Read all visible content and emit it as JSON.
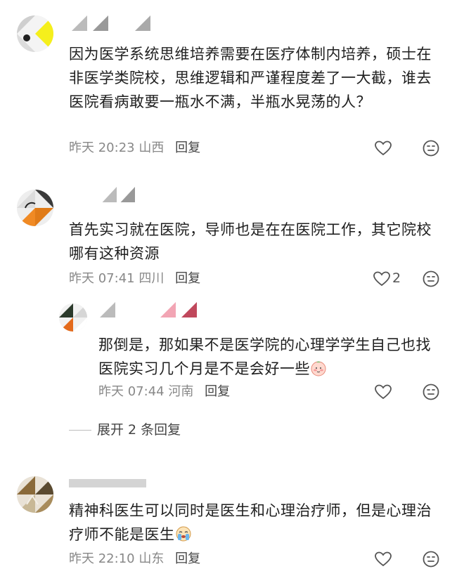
{
  "comments": [
    {
      "text": "因为医学系统思维培养需要在医疗体制内培养，硕士在非医学类院校，思维逻辑和严谨程度差了一大截，谁去医院看病敢要一瓶水不满，半瓶水晃荡的人？",
      "time": "昨天 20:23",
      "location": "山西",
      "reply_label": "回复",
      "like_icon": "heart-outline-icon",
      "dislike_icon": "neutral-face-icon"
    },
    {
      "text": "首先实习就在医院，导师也是在在医院工作，其它院校哪有这种资源",
      "time": "昨天 07:41",
      "location": "四川",
      "reply_label": "回复",
      "like_count": "2",
      "like_icon": "heart-outline-icon",
      "dislike_icon": "neutral-face-icon"
    },
    {
      "text": "那倒是，那如果不是医学院的心理学学生自己也找医院实习几个月是不是会好一些",
      "time": "昨天 07:44",
      "location": "河南",
      "reply_label": "回复",
      "emoji": "shy-face-emoji",
      "like_icon": "heart-outline-icon",
      "dislike_icon": "neutral-face-icon"
    },
    {
      "text": "精神科医生可以同时是医生和心理治疗师，但是心理治疗师不能是医生",
      "time": "昨天 22:10",
      "location": "山东",
      "reply_label": "回复",
      "emoji": "crying-face-emoji",
      "like_icon": "heart-outline-icon",
      "dislike_icon": "neutral-face-icon"
    }
  ],
  "expand_replies": {
    "label": "展开 2 条回复"
  },
  "colors": {
    "meta": "#888888",
    "text": "#1f1f1f",
    "reply": "#444444"
  }
}
